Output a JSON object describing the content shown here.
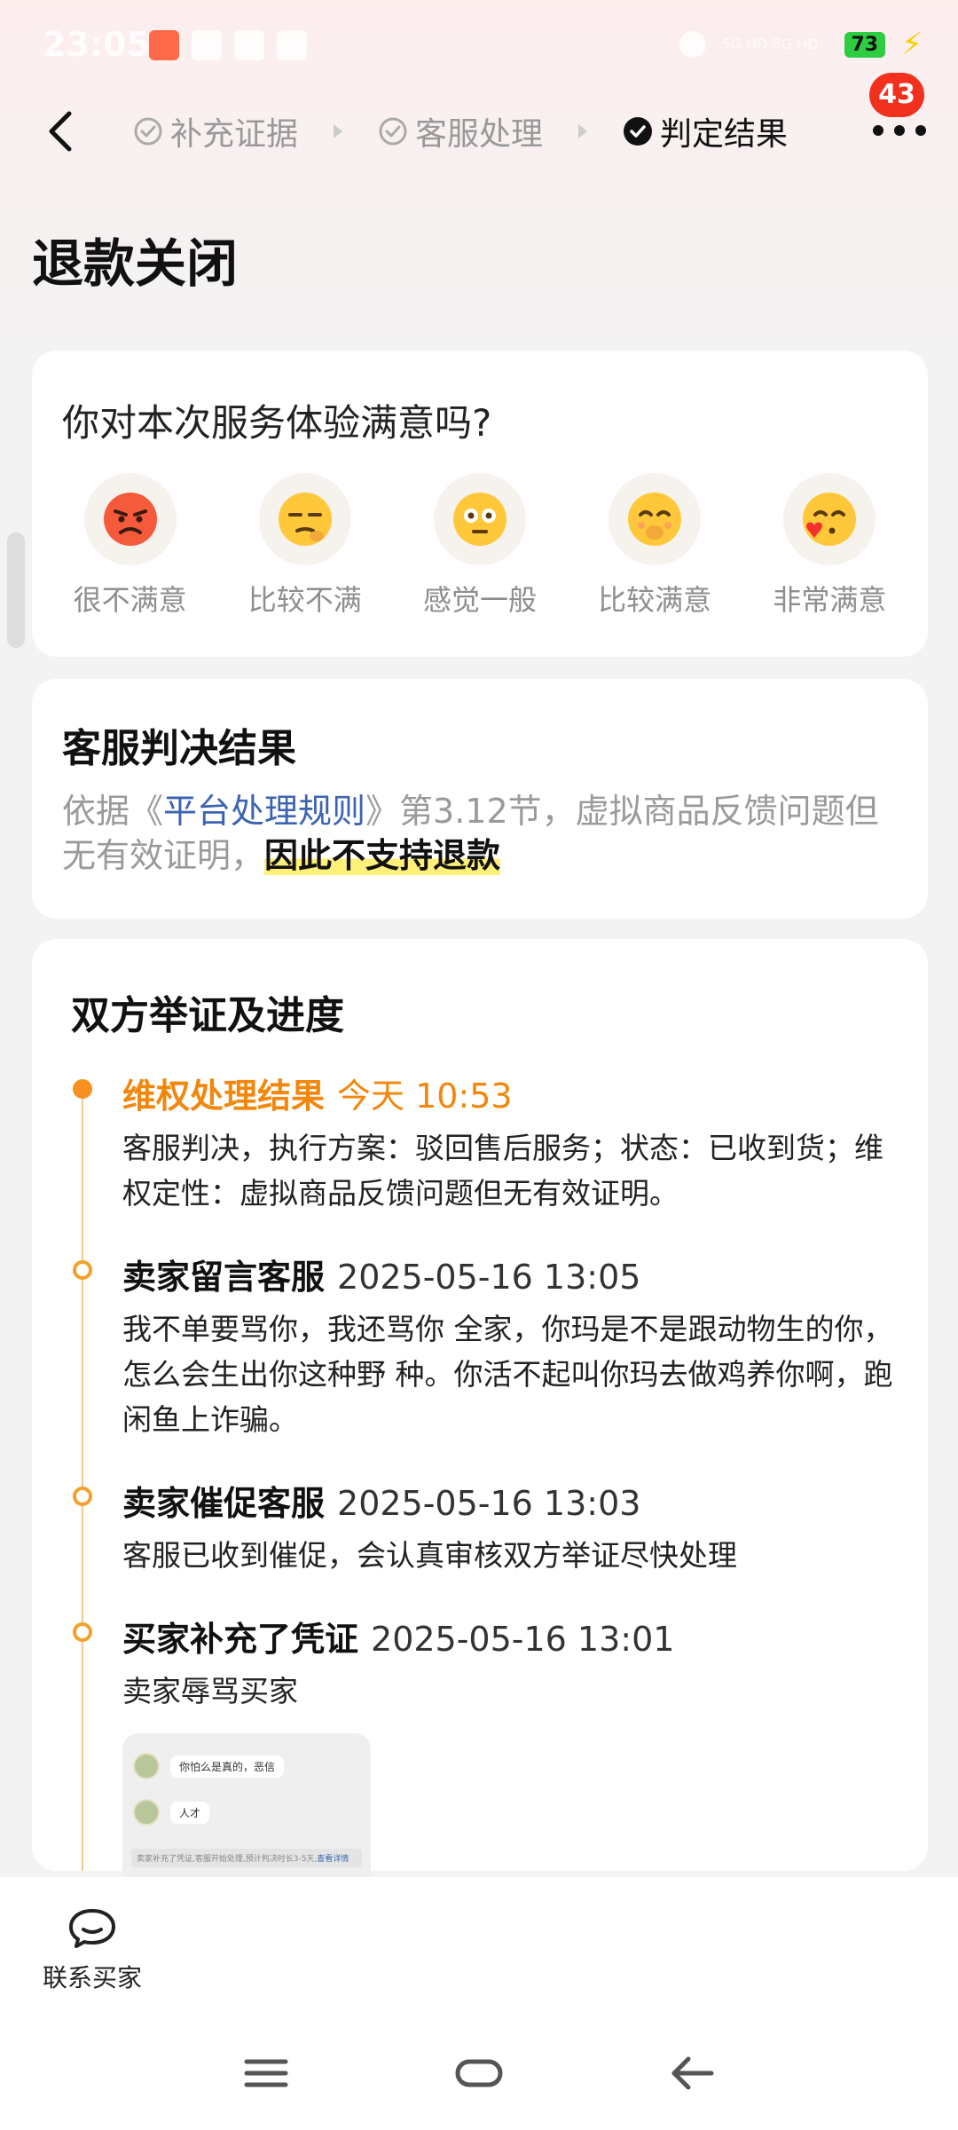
{
  "status_bar": {
    "time": "23:05",
    "network_text": "5G HD 5G HD",
    "battery": "73",
    "colors": {
      "battery": "#2ecc40"
    }
  },
  "header": {
    "steps": [
      {
        "label": "补充证据",
        "state": "done"
      },
      {
        "label": "客服处理",
        "state": "done"
      },
      {
        "label": "判定结果",
        "state": "current"
      }
    ],
    "notification_count": "43"
  },
  "page_title": "退款关闭",
  "satisfaction": {
    "question": "你对本次服务体验满意吗?",
    "options": [
      {
        "label": "很不满意",
        "icon": "angry-face-icon"
      },
      {
        "label": "比较不满",
        "icon": "unamused-face-icon"
      },
      {
        "label": "感觉一般",
        "icon": "neutral-face-icon"
      },
      {
        "label": "比较满意",
        "icon": "smiling-face-icon"
      },
      {
        "label": "非常满意",
        "icon": "kissing-face-icon"
      }
    ]
  },
  "verdict": {
    "title": "客服判决结果",
    "text_before": "依据《",
    "rule_link": "平台处理规则",
    "text_after": "》第3.12节，虚拟商品反馈问题但无有效证明，",
    "highlight": "因此不支持退款"
  },
  "progress": {
    "title": "双方举证及进度",
    "items": [
      {
        "heading": "维权处理结果",
        "time": "今天 10:53",
        "body": "客服判决，执行方案：驳回售后服务；状态：已收到货；维权定性：虚拟商品反馈问题但无有效证明。"
      },
      {
        "heading": "卖家留言客服",
        "time": "2025-05-16 13:05",
        "body": "我不单要骂你，我还骂你 全家，你玛是不是跟动物生的你，怎么会生出你这种野 种。你活不起叫你玛去做鸡养你啊，跑闲鱼上诈骗。"
      },
      {
        "heading": "卖家催促客服",
        "time": "2025-05-16 13:03",
        "body": "客服已收到催促，会认真审核双方举证尽快处理"
      },
      {
        "heading": "买家补充了凭证",
        "time": "2025-05-16 13:01",
        "body": "卖家辱骂买家"
      }
    ],
    "evidence_thumbnail": {
      "msg1": "你怕么是真的，恶信",
      "msg2": "人才",
      "footer_text": "卖家补充了凭证,客服开始处理,预计判决时长3-5天,",
      "footer_link": "查看详情"
    }
  },
  "bottom_bar": {
    "contact_label": "联系买家"
  }
}
